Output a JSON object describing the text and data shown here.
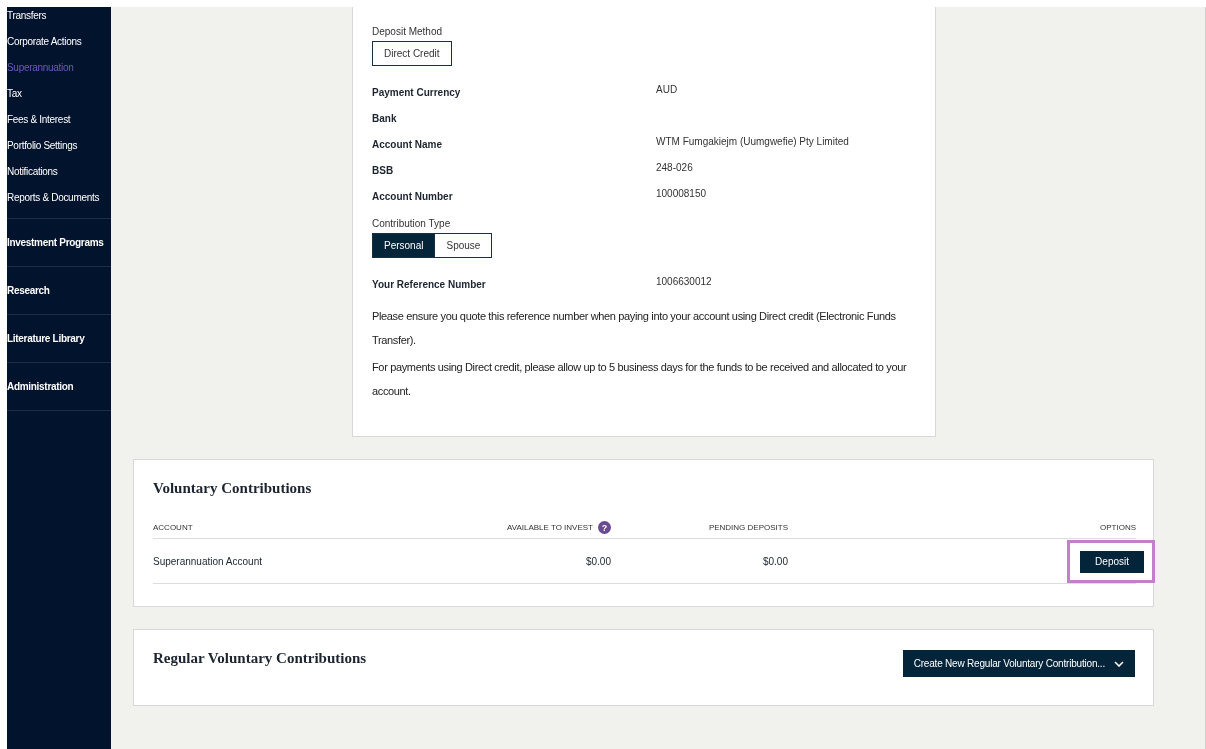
{
  "sidebar": {
    "items": [
      {
        "label": "Transfers",
        "kind": "sub",
        "selected": false
      },
      {
        "label": "Corporate Actions",
        "kind": "sub",
        "selected": false
      },
      {
        "label": "Superannuation",
        "kind": "sub",
        "selected": true
      },
      {
        "label": "Tax",
        "kind": "sub",
        "selected": false
      },
      {
        "label": "Fees & Interest",
        "kind": "sub",
        "selected": false
      },
      {
        "label": "Portfolio Settings",
        "kind": "sub",
        "selected": false
      },
      {
        "label": "Notifications",
        "kind": "sub",
        "selected": false
      },
      {
        "label": "Reports & Documents",
        "kind": "sub",
        "selected": false
      },
      {
        "label": "Investment Programs",
        "kind": "section",
        "selected": false
      },
      {
        "label": "Research",
        "kind": "section",
        "selected": false
      },
      {
        "label": "Literature Library",
        "kind": "section",
        "selected": false
      },
      {
        "label": "Administration",
        "kind": "section",
        "selected": false
      }
    ]
  },
  "deposit_details": {
    "deposit_method": {
      "label": "Deposit Method",
      "options": [
        {
          "label": "Direct Credit",
          "selected": false
        }
      ]
    },
    "fields": [
      {
        "label": "Payment Currency",
        "value": "AUD"
      },
      {
        "label": "Bank"
      },
      {
        "label": "Account Name",
        "value": "WTM Fumgakiejm (Uumgwefie) Pty Limited"
      },
      {
        "label": "BSB",
        "value": "248-026"
      },
      {
        "label": "Account Number",
        "value": "100008150"
      }
    ],
    "contribution_type": {
      "label": "Contribution Type",
      "options": [
        {
          "label": "Personal",
          "selected": true
        },
        {
          "label": "Spouse",
          "selected": false
        }
      ]
    },
    "reference": {
      "label": "Your Reference Number",
      "value": "1006630012"
    },
    "notes": [
      "Please ensure you quote this reference number when paying into your account using Direct credit (Electronic Funds Transfer).",
      "For payments using Direct credit, please allow up to 5 business days for the funds to be received and allocated to your account."
    ]
  },
  "voluntary_contributions": {
    "title": "Voluntary Contributions",
    "columns": [
      {
        "label": "ACCOUNT"
      },
      {
        "label": "AVAILABLE TO INVEST",
        "help": "?"
      },
      {
        "label": "PENDING DEPOSITS"
      },
      {
        "label": "OPTIONS"
      }
    ],
    "rows": [
      {
        "account": "Superannuation Account",
        "available": "$0.00",
        "pending": "$0.00",
        "button": "Deposit",
        "highlighted": true
      }
    ]
  },
  "regular_voluntary_contributions": {
    "title": "Regular Voluntary Contributions",
    "button": "Create New Regular Voluntary Contribution..."
  }
}
